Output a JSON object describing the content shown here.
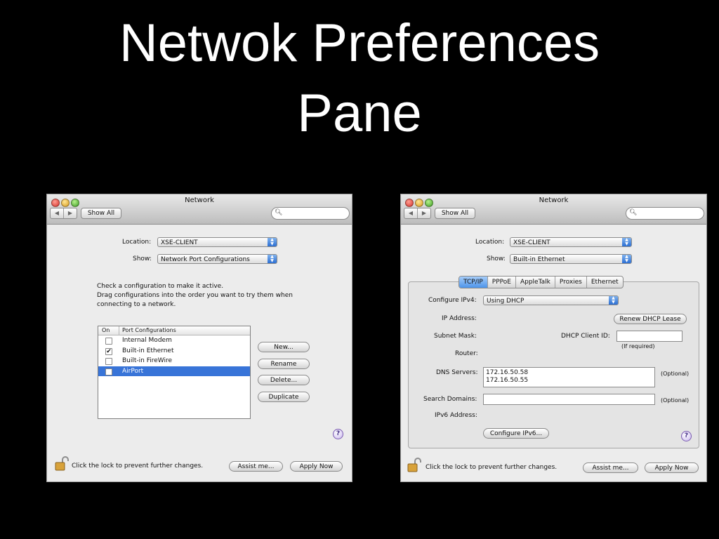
{
  "slide": {
    "title_line1": "Netwok Preferences",
    "title_line2": "Pane"
  },
  "left_window": {
    "title": "Network",
    "nav_back": "◀",
    "nav_fwd": "▶",
    "show_all": "Show All",
    "location_label": "Location:",
    "location_value": "XSE-CLIENT",
    "show_label": "Show:",
    "show_value": "Network Port Configurations",
    "instructions": [
      "Check a configuration to make it active.",
      "Drag configurations into the order you want to try them when",
      "connecting to a network."
    ],
    "table_headers": {
      "on": "On",
      "port": "Port Configurations"
    },
    "ports": [
      {
        "name": "Internal Modem",
        "checked": false
      },
      {
        "name": "Built-in Ethernet",
        "checked": true
      },
      {
        "name": "Built-in FireWire",
        "checked": false
      },
      {
        "name": "AirPort",
        "checked": false,
        "selected": true
      }
    ],
    "check_mark": "✔",
    "buttons": {
      "new": "New...",
      "rename": "Rename",
      "delete": "Delete...",
      "duplicate": "Duplicate"
    },
    "help": "?",
    "lock_text": "Click the lock to prevent further changes.",
    "assist_me": "Assist me...",
    "apply_now": "Apply Now"
  },
  "right_window": {
    "title": "Network",
    "nav_back": "◀",
    "nav_fwd": "▶",
    "show_all": "Show All",
    "location_label": "Location:",
    "location_value": "XSE-CLIENT",
    "show_label": "Show:",
    "show_value": "Built-in Ethernet",
    "tabs": [
      "TCP/IP",
      "PPPoE",
      "AppleTalk",
      "Proxies",
      "Ethernet"
    ],
    "configure_label": "Configure IPv4:",
    "configure_value": "Using DHCP",
    "ip_label": "IP Address:",
    "renew_button": "Renew DHCP Lease",
    "subnet_label": "Subnet Mask:",
    "client_id_label": "DHCP Client ID:",
    "client_id_value": "",
    "if_required": "(If required)",
    "router_label": "Router:",
    "dns_label": "DNS Servers:",
    "dns_values": [
      "172.16.50.58",
      "172.16.50.55"
    ],
    "optional": "(Optional)",
    "search_label": "Search Domains:",
    "search_value": "",
    "ipv6_label": "IPv6 Address:",
    "configure_ipv6_button": "Configure IPv6...",
    "help": "?",
    "lock_text": "Click the lock to prevent further changes.",
    "assist_me": "Assist me...",
    "apply_now": "Apply Now"
  },
  "icons": {
    "search": "magnifier-icon",
    "lock": "padlock-icon",
    "popup_arrows": "up-down-arrows-icon"
  },
  "colors": {
    "selection": "#3874d8",
    "tab_active": "#4d94ea",
    "background": "#000000"
  }
}
